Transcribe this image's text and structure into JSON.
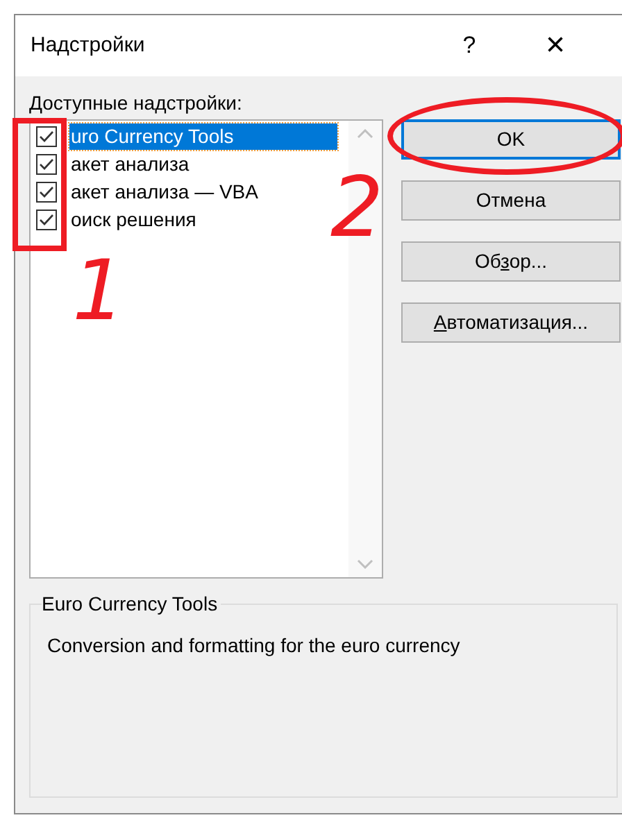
{
  "window": {
    "title": "Надстройки",
    "help": "?",
    "close": "×"
  },
  "list_label": "Доступные надстройки:",
  "addins": [
    {
      "label": "uro Currency Tools",
      "checked": true,
      "selected": true
    },
    {
      "label": "акет анализа",
      "checked": true,
      "selected": false
    },
    {
      "label": "акет анализа — VBA",
      "checked": true,
      "selected": false
    },
    {
      "label": "оиск решения",
      "checked": true,
      "selected": false
    }
  ],
  "buttons": [
    {
      "text": "OK",
      "default": true
    },
    {
      "text": "Отмена",
      "default": false
    },
    {
      "before": "Об",
      "key": "з",
      "after": "ор...",
      "default": false
    },
    {
      "key": "А",
      "after": "втоматизация...",
      "default": false
    }
  ],
  "description": {
    "title": "Euro Currency Tools",
    "text": "Conversion and formatting for the euro currency"
  },
  "annotations": [
    {
      "kind": "number",
      "text": "1"
    },
    {
      "kind": "number",
      "text": "2"
    }
  ]
}
